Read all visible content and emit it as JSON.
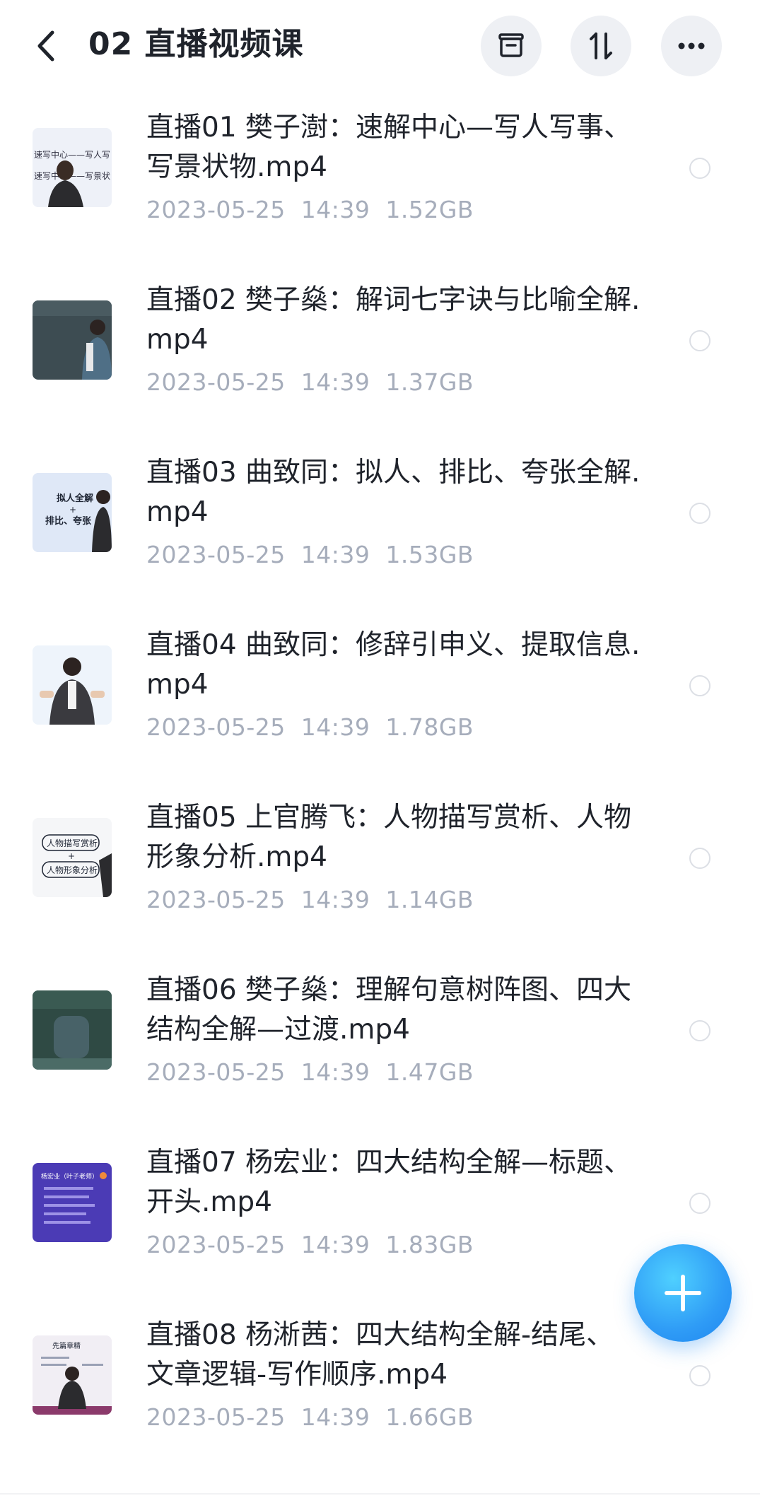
{
  "header": {
    "title": "02 直播视频课",
    "back_icon": "chevron-left-icon",
    "actions": [
      {
        "icon": "archive-box-icon"
      },
      {
        "icon": "sort-icon"
      },
      {
        "icon": "more-dots-icon"
      }
    ]
  },
  "files": [
    {
      "name": "直播01  樊子澍：速解中心—写人写事、写景状物.mp4",
      "date": "2023-05-25",
      "time": "14:39",
      "size": "1.52GB",
      "thumb": {
        "texts": [
          "速写中心——写人写",
          "速写中心——写景状"
        ]
      }
    },
    {
      "name": "直播02  樊子燊：解词七字诀与比喻全解.mp4",
      "date": "2023-05-25",
      "time": "14:39",
      "size": "1.37GB",
      "thumb": {
        "texts": []
      }
    },
    {
      "name": "直播03  曲致同：拟人、排比、夸张全解.mp4",
      "date": "2023-05-25",
      "time": "14:39",
      "size": "1.53GB",
      "thumb": {
        "texts": [
          "拟人全解",
          "+",
          "排比、夸张"
        ]
      }
    },
    {
      "name": "直播04  曲致同：修辞引申义、提取信息.mp4",
      "date": "2023-05-25",
      "time": "14:39",
      "size": "1.78GB",
      "thumb": {
        "texts": []
      }
    },
    {
      "name": "直播05 上官腾飞：人物描写赏析、人物形象分析.mp4",
      "date": "2023-05-25",
      "time": "14:39",
      "size": "1.14GB",
      "thumb": {
        "texts": [
          "人物描写赏析",
          "+",
          "人物形象分析"
        ]
      }
    },
    {
      "name": "直播06  樊子燊：理解句意树阵图、四大结构全解—过渡.mp4",
      "date": "2023-05-25",
      "time": "14:39",
      "size": "1.47GB",
      "thumb": {
        "texts": []
      }
    },
    {
      "name": "直播07  杨宏业：四大结构全解—标题、开头.mp4",
      "date": "2023-05-25",
      "time": "14:39",
      "size": "1.83GB",
      "thumb": {
        "texts": [
          "杨宏业（叶子老师）"
        ]
      }
    },
    {
      "name": "直播08  杨淅茜：四大结构全解-结尾、文章逻辑-写作顺序.mp4",
      "date": "2023-05-25",
      "time": "14:39",
      "size": "1.66GB",
      "thumb": {
        "texts": [
          "先篇章精"
        ]
      }
    }
  ],
  "fab": {
    "icon": "plus-icon"
  },
  "colors": {
    "title": "#1f232b",
    "meta": "#a6adbb",
    "fab": "#2f9cf6",
    "button_bg": "#eef0f4",
    "radio_border": "#dcdfe5"
  }
}
